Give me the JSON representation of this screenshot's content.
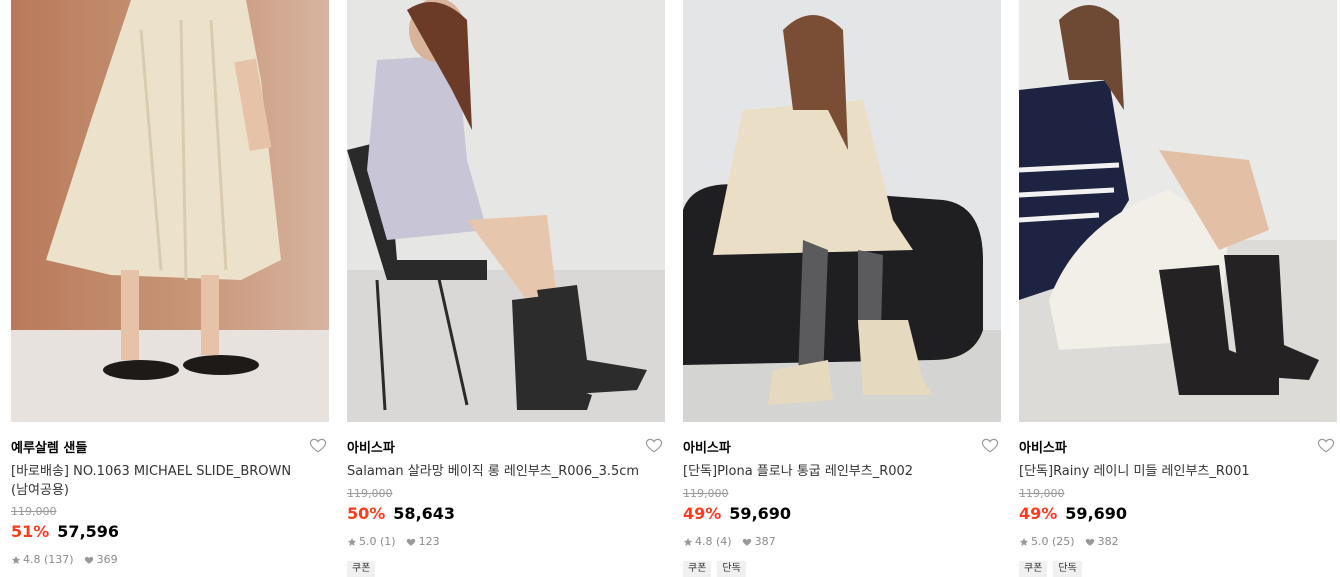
{
  "products": [
    {
      "brand": "예루살렘 샌들",
      "title": "[바로배송] NO.1063 MICHAEL SLIDE_BROWN (남여공용)",
      "original_price": "119,000",
      "discount": "51%",
      "price": "57,596",
      "rating": "4.8",
      "reviews": "(137)",
      "likes": "369",
      "badges": []
    },
    {
      "brand": "아비스파",
      "title": "Salaman 살라망 베이직 롱 레인부츠_R006_3.5cm",
      "original_price": "119,000",
      "discount": "50%",
      "price": "58,643",
      "rating": "5.0",
      "reviews": "(1)",
      "likes": "123",
      "badges": [
        "쿠폰"
      ]
    },
    {
      "brand": "아비스파",
      "title": "[단독]Plona 플로나 통굽 레인부츠_R002",
      "original_price": "119,000",
      "discount": "49%",
      "price": "59,690",
      "rating": "4.8",
      "reviews": "(4)",
      "likes": "387",
      "badges": [
        "쿠폰",
        "단독"
      ]
    },
    {
      "brand": "아비스파",
      "title": "[단독]Rainy 레이니 미들 레인부츠_R001",
      "original_price": "119,000",
      "discount": "49%",
      "price": "59,690",
      "rating": "5.0",
      "reviews": "(25)",
      "likes": "382",
      "badges": [
        "쿠폰",
        "단독"
      ]
    }
  ],
  "colors": {
    "discount": "#ff3b1f",
    "muted": "#999999",
    "badge_bg": "#f0f0f0"
  },
  "icons": {
    "wishlist": "heart-outline-icon",
    "rating": "star-icon",
    "likes": "heart-filled-icon"
  }
}
